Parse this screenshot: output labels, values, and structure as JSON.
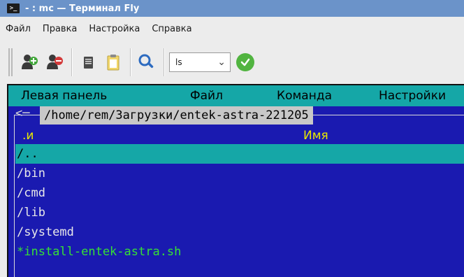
{
  "window": {
    "title": "- : mc — Терминал Fly",
    "icon_glyph": ">_"
  },
  "menubar": {
    "items": [
      "Файл",
      "Правка",
      "Настройка",
      "Справка"
    ]
  },
  "toolbar": {
    "buttons": [
      "new-tab-icon",
      "close-tab-icon",
      "copy-icon",
      "paste-icon",
      "find-icon"
    ],
    "combo_value": "ls",
    "combo_chevron": "⌄",
    "execute_icon": "checkmark-icon"
  },
  "mc": {
    "menu": {
      "left_panel": "Левая панель",
      "file": "Файл",
      "command": "Команда",
      "settings": "Настройки"
    },
    "panel": {
      "arrow": "<─",
      "path": "/home/rem/Загрузки/entek-astra-221205",
      "sort_indicator": ".и",
      "name_header": "Имя",
      "files": [
        {
          "name": "/..",
          "selected": true
        },
        {
          "name": "/bin"
        },
        {
          "name": "/cmd"
        },
        {
          "name": "/lib"
        },
        {
          "name": "/systemd"
        },
        {
          "name": "*install-entek-astra.sh",
          "executable": true
        }
      ]
    }
  },
  "colors": {
    "titlebar_bg": "#6b93c9",
    "terminal_bg": "#1a1ab0",
    "cyan": "#15a7a7",
    "header_yellow": "#e8e800",
    "exec_green": "#35e035"
  }
}
